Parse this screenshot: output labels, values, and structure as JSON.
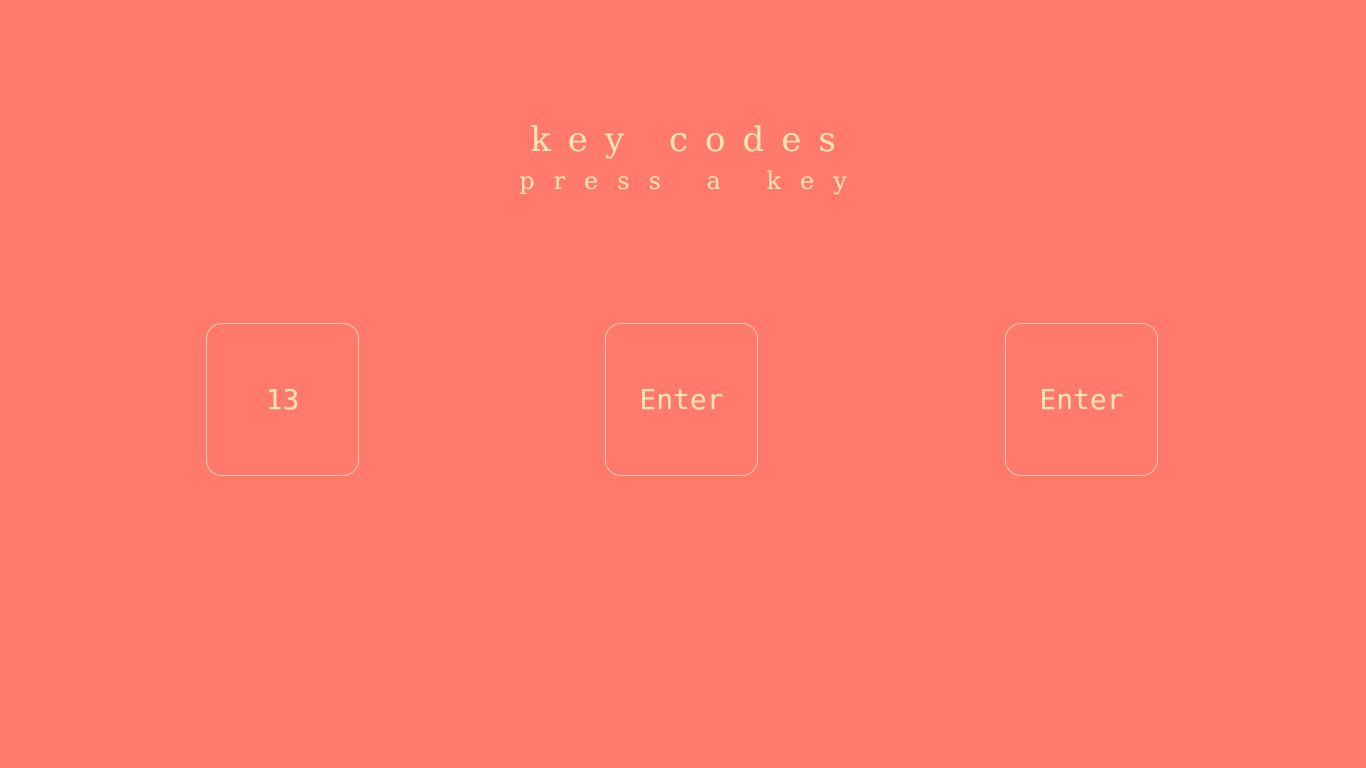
{
  "header": {
    "title": "Key Codes",
    "subtitle": "Press a key"
  },
  "keys": [
    {
      "value": "13"
    },
    {
      "value": "Enter"
    },
    {
      "value": "Enter"
    }
  ],
  "colors": {
    "background": "#ff7a6a",
    "text": "#ffe6b8",
    "border": "#ffe6d2"
  }
}
